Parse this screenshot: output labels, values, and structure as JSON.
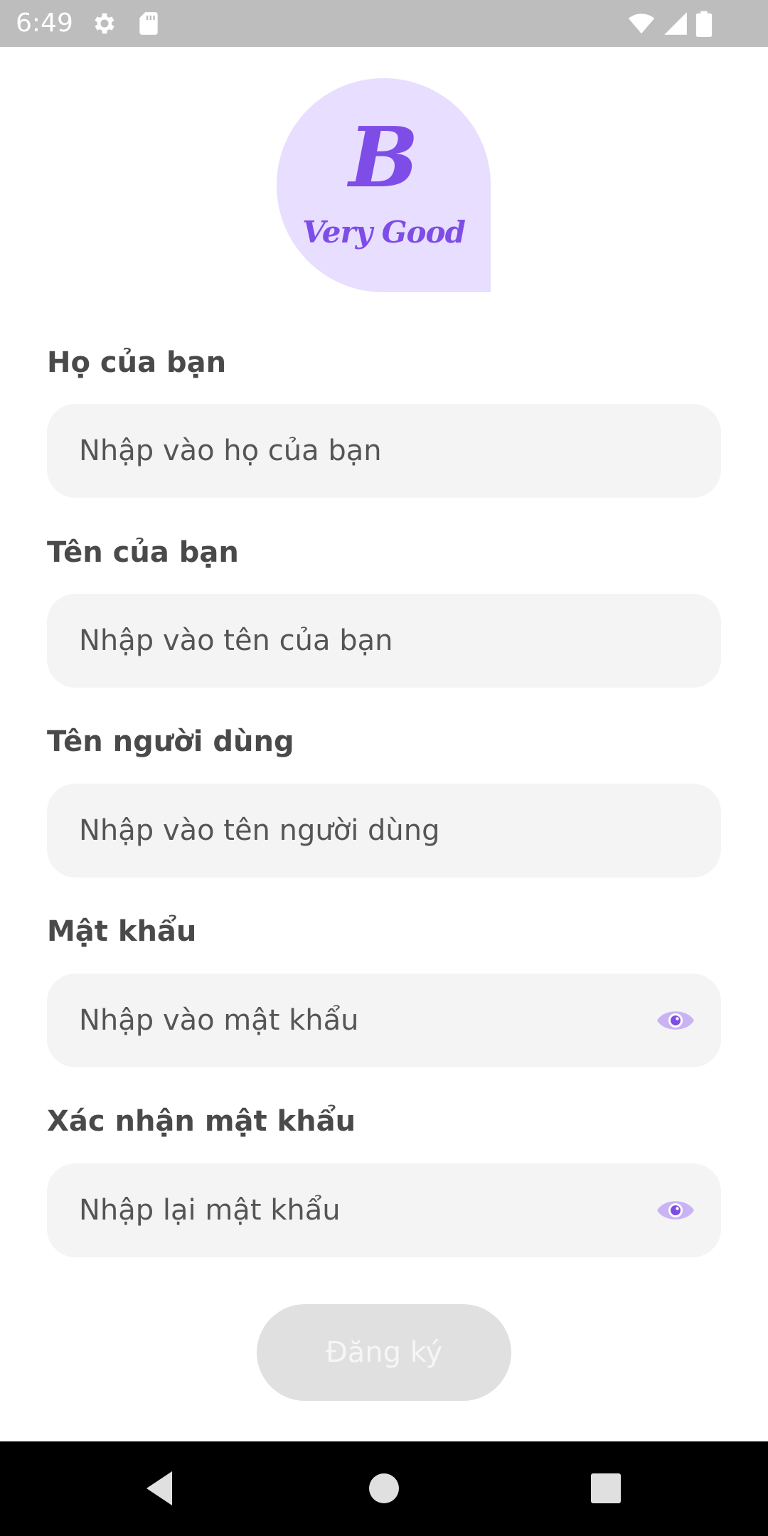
{
  "status_bar": {
    "time": "6:49",
    "icons": [
      "gear-icon",
      "sd-card-icon",
      "wifi-icon",
      "signal-icon",
      "battery-icon"
    ]
  },
  "logo": {
    "letter": "B",
    "caption": "Very Good",
    "background_color": "#e8deff",
    "accent_color": "#7e4ce6"
  },
  "form": {
    "last_name": {
      "label": "Họ của bạn",
      "placeholder": "Nhập vào họ của bạn"
    },
    "first_name": {
      "label": "Tên của bạn",
      "placeholder": "Nhập vào tên của bạn"
    },
    "username": {
      "label": "Tên người dùng",
      "placeholder": "Nhập vào tên người dùng"
    },
    "password": {
      "label": "Mật khẩu",
      "placeholder": "Nhập vào mật khẩu",
      "toggle_icon": "eye-icon"
    },
    "confirm_password": {
      "label": "Xác nhận mật khẩu",
      "placeholder": "Nhập lại mật khẩu",
      "toggle_icon": "eye-icon"
    },
    "submit_label": "Đăng ký"
  },
  "nav_bar": {
    "icons": [
      "back-icon",
      "home-icon",
      "recents-icon"
    ]
  }
}
